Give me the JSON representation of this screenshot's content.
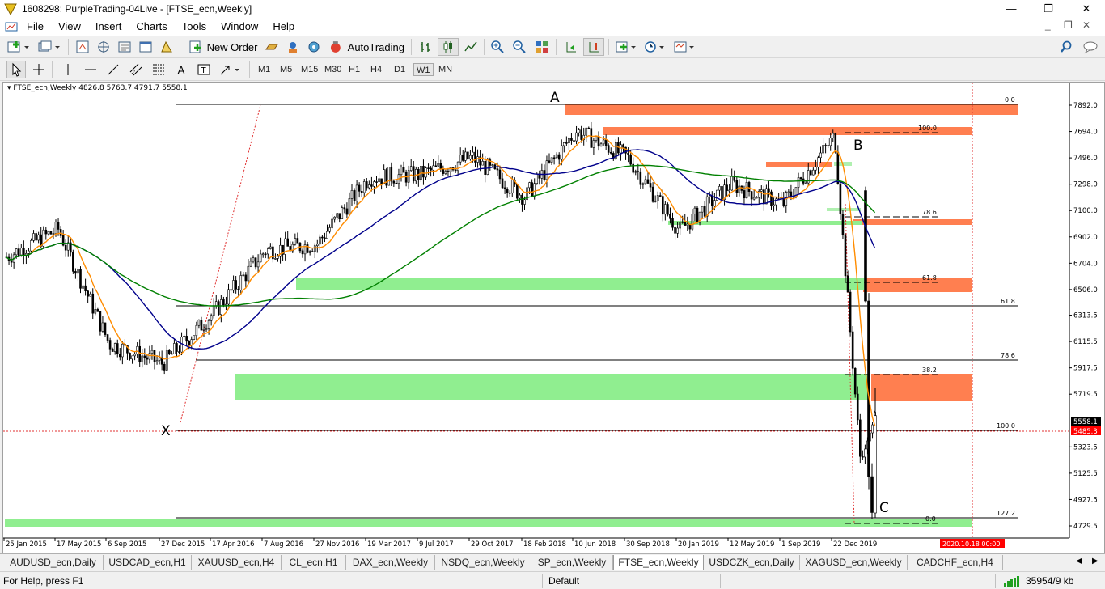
{
  "window": {
    "title": "1608298: PurpleTrading-04Live - [FTSE_ecn,Weekly]",
    "min": "—",
    "max": "❐",
    "close": "✕"
  },
  "menu": [
    "File",
    "View",
    "Insert",
    "Charts",
    "Tools",
    "Window",
    "Help"
  ],
  "toolbar": {
    "new_order": "New Order",
    "autotrading": "AutoTrading"
  },
  "timeframes": [
    "M1",
    "M5",
    "M15",
    "M30",
    "H1",
    "H4",
    "D1",
    "W1",
    "MN"
  ],
  "active_timeframe": "W1",
  "chart": {
    "header": "FTSE_ecn,Weekly  4826.8 5763.7 4791.7 5558.1",
    "price_labels": [
      "7892.0",
      "7694.0",
      "7496.0",
      "7298.0",
      "7100.0",
      "6902.0",
      "6704.0",
      "6506.0",
      "6313.5",
      "6115.5",
      "5917.5",
      "5719.5",
      "5323.5",
      "5125.5",
      "4927.5",
      "4729.5"
    ],
    "bid": "5558.1",
    "ask": "5485.3",
    "date_labels": [
      "25 Jan 2015",
      "17 May 2015",
      "6 Sep 2015",
      "27 Dec 2015",
      "17 Apr 2016",
      "7 Aug 2016",
      "27 Nov 2016",
      "19 Mar 2017",
      "9 Jul 2017",
      "29 Oct 2017",
      "18 Feb 2018",
      "10 Jun 2018",
      "30 Sep 2018",
      "20 Jan 2019",
      "12 May 2019",
      "1 Sep 2019",
      "22 Dec 2019"
    ],
    "time_marker": "2020.10.18 00:00",
    "pattern_points": [
      "A",
      "B",
      "X",
      "C"
    ],
    "fib_labels_left": [
      "0.0",
      "61.8",
      "78.6",
      "100.0",
      "127.2"
    ],
    "fib_labels_right": [
      "100.0",
      "78.6",
      "61.8",
      "38.2",
      "0.0"
    ]
  },
  "chart_data": {
    "type": "line",
    "title": "FTSE_ecn,Weekly",
    "ohlc_current": {
      "open": 4826.8,
      "high": 5763.7,
      "low": 4791.7,
      "close": 5558.1
    },
    "x": [
      "2015-01-25",
      "2015-05-17",
      "2015-09-06",
      "2015-12-27",
      "2016-04-17",
      "2016-08-07",
      "2016-11-27",
      "2017-03-19",
      "2017-07-09",
      "2017-10-29",
      "2018-02-18",
      "2018-06-10",
      "2018-09-30",
      "2019-01-20",
      "2019-05-12",
      "2019-09-01",
      "2019-12-22",
      "2020-03-22",
      "2020-04-26"
    ],
    "series": [
      {
        "values": [
          6750,
          6960,
          6100,
          5950,
          6330,
          6800,
          6850,
          7350,
          7370,
          7500,
          7200,
          7700,
          7500,
          6950,
          7300,
          7150,
          7660,
          5200,
          5558
        ]
      }
    ],
    "ylim": [
      4700,
      8000
    ],
    "colors": {
      "bull": "#000000",
      "ma_fast": "#ff8c00",
      "ma_mid": "#00008b",
      "ma_slow": "#008000",
      "supply": "#ff7f50",
      "demand": "#90ee90"
    }
  },
  "tabs": [
    "AUDUSD_ecn,Daily",
    "USDCAD_ecn,H1",
    "XAUUSD_ecn,H4",
    "CL_ecn,H1",
    "DAX_ecn,Weekly",
    "NSDQ_ecn,Weekly",
    "SP_ecn,Weekly",
    "FTSE_ecn,Weekly",
    "USDCZK_ecn,Daily",
    "XAGUSD_ecn,Weekly",
    "CADCHF_ecn,H4"
  ],
  "active_tab": "FTSE_ecn,Weekly",
  "status": {
    "help": "For Help, press F1",
    "profile": "Default",
    "traffic": "35954/9 kb"
  }
}
